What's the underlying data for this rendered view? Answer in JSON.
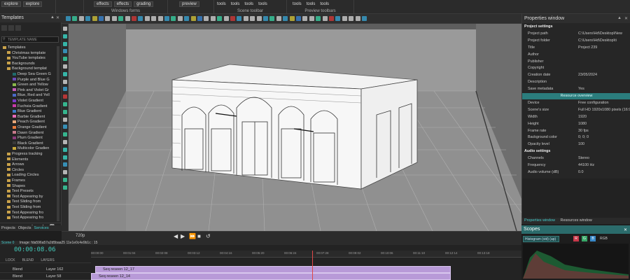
{
  "toolbar": {
    "dropdowns": [
      "explore",
      "explore",
      "effects",
      "effects",
      "grading",
      "preview"
    ],
    "windows_caption": "Windows forms",
    "scene_caption": "Scene toolbar",
    "preview_caption": "Preview toolbars",
    "tools_labels": [
      "tools",
      "tools",
      "tools",
      "tools",
      "tools",
      "tools",
      "tools"
    ]
  },
  "templates": {
    "title": "Templates",
    "search_placeholder": "TEMPLATE NAME",
    "items": [
      {
        "label": "Templates",
        "color": ""
      },
      {
        "label": "Christmas template",
        "color": ""
      },
      {
        "label": "YouTube templates",
        "color": ""
      },
      {
        "label": "Backgrounds",
        "color": ""
      },
      {
        "label": "Background templat",
        "color": ""
      },
      {
        "label": "Deep Sea Green G",
        "color": "#1e6b6b"
      },
      {
        "label": "Purple and Blue G",
        "color": "#6a4ab8"
      },
      {
        "label": "Green and Yellow",
        "color": "#8ab84a"
      },
      {
        "label": "Pink and Violet Gr",
        "color": "#c45ab8"
      },
      {
        "label": "Blue, Red and Yell",
        "color": "#4a6ac8"
      },
      {
        "label": "Violet Gradient",
        "color": "#7a3ac8"
      },
      {
        "label": "Fuchsia Gradient",
        "color": "#c83aa8"
      },
      {
        "label": "Blue Gradient",
        "color": "#3a7ac8"
      },
      {
        "label": "Barbie Gradient",
        "color": "#e86ab8"
      },
      {
        "label": "Peach Gradient",
        "color": "#e8a87a"
      },
      {
        "label": "Orange Gradient",
        "color": "#e87a3a"
      },
      {
        "label": "Dawn Gradient",
        "color": "#c87a8a"
      },
      {
        "label": "Plum Gradient",
        "color": "#8a3a7a"
      },
      {
        "label": "Black Gradient",
        "color": "#3a3a3a"
      },
      {
        "label": "Multicolor Gradien",
        "color": "#c8a83a"
      },
      {
        "label": "Progress tracking",
        "color": ""
      },
      {
        "label": "Elements",
        "color": ""
      },
      {
        "label": "Arrows",
        "color": ""
      },
      {
        "label": "Circles",
        "color": ""
      },
      {
        "label": "Loading Circles",
        "color": ""
      },
      {
        "label": "Frames",
        "color": ""
      },
      {
        "label": "Shapes",
        "color": ""
      },
      {
        "label": "Text Presets",
        "color": ""
      },
      {
        "label": "Text Appearing by",
        "color": ""
      },
      {
        "label": "Text Sliding from",
        "color": ""
      },
      {
        "label": "Text Sliding from",
        "color": ""
      },
      {
        "label": "Text Appearing fro",
        "color": ""
      },
      {
        "label": "Text Appearing fro",
        "color": ""
      }
    ],
    "bottom_tabs": [
      "Projects",
      "Objects",
      "Services"
    ]
  },
  "properties": {
    "title": "Properties window",
    "rows": [
      {
        "k": "Project settings",
        "v": "",
        "section": true
      },
      {
        "k": "Project path",
        "v": "C:\\Users\\Hd\\Desktop\\New",
        "section": false
      },
      {
        "k": "Project folder",
        "v": "C:\\Users\\Hd\\Desktop\\ti",
        "section": false
      },
      {
        "k": "Title",
        "v": "Project 239",
        "section": false
      },
      {
        "k": "Author",
        "v": "",
        "section": false
      },
      {
        "k": "Publisher",
        "v": "",
        "section": false
      },
      {
        "k": "Copyright",
        "v": "",
        "section": false
      },
      {
        "k": "Creation date",
        "v": "23/05/2024",
        "section": false
      },
      {
        "k": "Description",
        "v": "",
        "section": false
      },
      {
        "k": "Save metadata",
        "v": "Yes",
        "section": false
      },
      {
        "k": "Resource overview",
        "v": "",
        "section": false,
        "button": true
      },
      {
        "k": "Device",
        "v": "Free configuration",
        "section": false
      },
      {
        "k": "Scene's size",
        "v": "Full HD 1920x1080 pixels (16:9)",
        "section": false
      },
      {
        "k": "Width",
        "v": "1920",
        "section": false
      },
      {
        "k": "Height",
        "v": "1080",
        "section": false
      },
      {
        "k": "Frame rate",
        "v": "30 fps",
        "section": false
      },
      {
        "k": "Background color",
        "v": "0; 0; 0",
        "section": false
      },
      {
        "k": "Opacity level",
        "v": "100",
        "section": false
      },
      {
        "k": "Audio settings",
        "v": "",
        "section": true
      },
      {
        "k": "Channels",
        "v": "Stereo",
        "section": false
      },
      {
        "k": "Frequency",
        "v": "44100 Hz",
        "section": false
      },
      {
        "k": "Audio volume (dB)",
        "v": "0.0",
        "section": false
      }
    ],
    "tabs": [
      "Properties window",
      "Resources window"
    ]
  },
  "scopes": {
    "title": "Scopes",
    "mode": "Histogram (vid) (ap)",
    "channels": [
      "R",
      "G",
      "B"
    ],
    "channel_label": "RGB"
  },
  "transport": {
    "zoom": "720p",
    "timecode": "00:00:08.06"
  },
  "timeline": {
    "tabs": [
      "Scene 0",
      "Image: fda596a57a2d5baa25 11e1e0c4e9b1c : 15"
    ],
    "header_cols": [
      "LOCK",
      "BLEND",
      "LAYERS"
    ],
    "layers": [
      {
        "blend": "Blend",
        "name": "Layer 162"
      },
      {
        "blend": "Blend",
        "name": "Layer 58"
      }
    ],
    "clips": [
      "Seq reseen 12_17",
      "Seq reseen 12_14"
    ],
    "ruler_marks": [
      "00:00:00",
      "00:01:04",
      "00:02:08",
      "00:03:12",
      "00:04:16",
      "00:05:20",
      "00:06:24",
      "00:07:28",
      "00:09:02",
      "00:10:06",
      "00:11:10",
      "00:12:14",
      "00:13:18"
    ]
  },
  "colors": {
    "accent": "#2b7d7d",
    "clip": "#b89ad8",
    "timecode": "#43c8b8"
  }
}
